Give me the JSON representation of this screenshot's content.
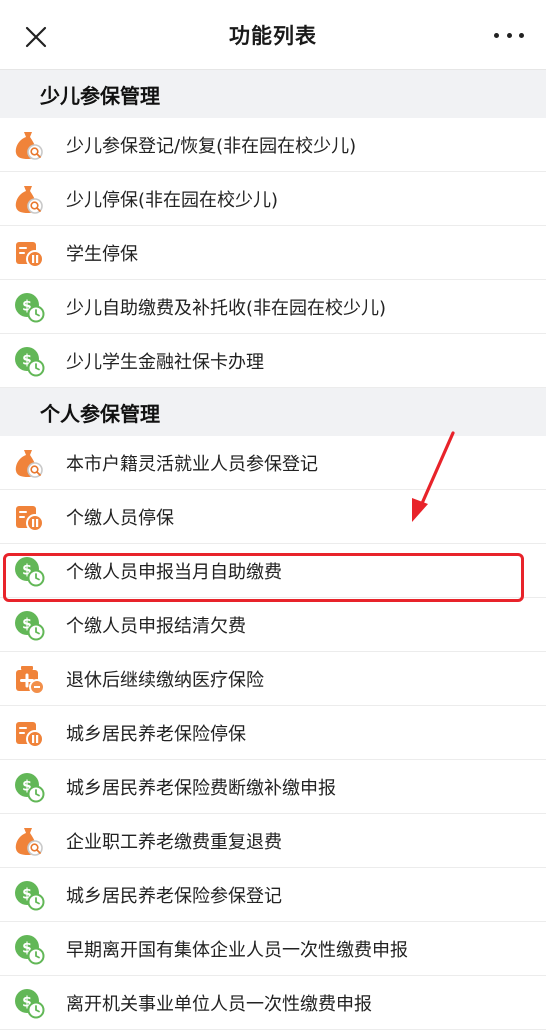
{
  "header": {
    "title": "功能列表"
  },
  "sections": [
    {
      "title": "少儿参保管理",
      "items": [
        {
          "label": "少儿参保登记/恢复(非在园在校少儿)",
          "icon": "moneybag-search-icon"
        },
        {
          "label": "少儿停保(非在园在校少儿)",
          "icon": "moneybag-search-icon"
        },
        {
          "label": "学生停保",
          "icon": "pause-card-icon"
        },
        {
          "label": "少儿自助缴费及补托收(非在园在校少儿)",
          "icon": "coin-clock-icon"
        },
        {
          "label": "少儿学生金融社保卡办理",
          "icon": "coin-clock-icon"
        }
      ]
    },
    {
      "title": "个人参保管理",
      "items": [
        {
          "label": "本市户籍灵活就业人员参保登记",
          "icon": "moneybag-search-icon"
        },
        {
          "label": "个缴人员停保",
          "icon": "pause-card-icon"
        },
        {
          "label": "个缴人员申报当月自助缴费",
          "icon": "coin-clock-icon"
        },
        {
          "label": "个缴人员申报结清欠费",
          "icon": "coin-clock-icon"
        },
        {
          "label": "退休后继续缴纳医疗保险",
          "icon": "medical-box-icon"
        },
        {
          "label": "城乡居民养老保险停保",
          "icon": "pause-card-icon"
        },
        {
          "label": "城乡居民养老保险费断缴补缴申报",
          "icon": "coin-clock-icon"
        },
        {
          "label": "企业职工养老缴费重复退费",
          "icon": "moneybag-search-icon"
        },
        {
          "label": "城乡居民养老保险参保登记",
          "icon": "coin-clock-icon"
        },
        {
          "label": "早期离开国有集体企业人员一次性缴费申报",
          "icon": "coin-clock-icon"
        },
        {
          "label": "离开机关事业单位人员一次性缴费申报",
          "icon": "coin-clock-icon"
        }
      ]
    }
  ],
  "colors": {
    "orange": "#f0833a",
    "green": "#62b757",
    "annotation_red": "#e8232a"
  }
}
